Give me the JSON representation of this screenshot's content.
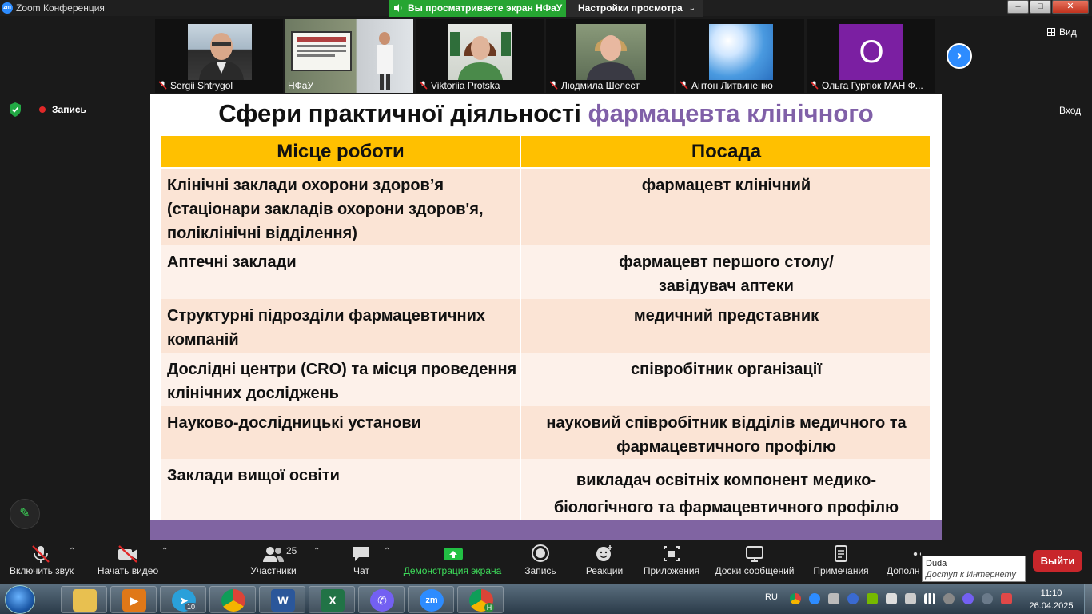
{
  "window": {
    "title": "Zoom Конференция",
    "share_banner": "Вы просматриваете экран НФаУ",
    "view_options": "Настройки просмотра",
    "minimize": "–",
    "maximize": "□",
    "close": "✕"
  },
  "participants_strip": {
    "tiles": [
      {
        "name": "Sergii Shtrygol",
        "muted": true
      },
      {
        "name": "НФаУ",
        "muted": false,
        "active": true
      },
      {
        "name": "Viktoriia Protska",
        "muted": true
      },
      {
        "name": "Людмила Шелест",
        "muted": true
      },
      {
        "name": "Антон Литвиненко",
        "muted": true
      },
      {
        "name": "Ольга Гуртюк МАН Ф...",
        "muted": true,
        "avatar_letter": "О"
      }
    ],
    "next_arrow": "›",
    "view_button": "Вид"
  },
  "recording": {
    "label": "Запись"
  },
  "signin": {
    "label": "Вход"
  },
  "slide": {
    "title_main": "Сфери практичної діяльності ",
    "title_accent": "фармацевта клінічного",
    "table": {
      "headers": [
        "Місце роботи",
        "Посада"
      ],
      "rows": [
        {
          "place": "Клінічні заклади охорони здоров’я (стаціонари закладів охорони здоров'я, поліклінічні відділення)",
          "position": "фармацевт клінічний"
        },
        {
          "place": "Аптечні заклади",
          "position": "фармацевт першого столу/ завідувач аптеки"
        },
        {
          "place": "Структурні підрозділи  фармацевтичних компаній",
          "position": "медичний представник"
        },
        {
          "place": "Дослідні центри (CRO) та місця проведення клінічних досліджень",
          "position": "співробітник організації"
        },
        {
          "place": "Науково-дослідницькі установи",
          "position": "науковий співробітник відділів медичного та фармацевтичного профілю"
        },
        {
          "place": "Заклади вищої освіти",
          "position": "викладач освітніх компонент медико-біологічного та фармацевтичного профілю"
        }
      ]
    }
  },
  "toolbar": {
    "unmute": "Включить звук",
    "start_video": "Начать видео",
    "participants": "Участники",
    "participants_count": "25",
    "chat": "Чат",
    "share_screen": "Демонстрация экрана",
    "record": "Запись",
    "reactions": "Реакции",
    "apps": "Приложения",
    "whiteboards": "Доски сообщений",
    "notes": "Примечания",
    "more": "Дополн",
    "leave": "Выйти"
  },
  "tooltip": {
    "title": "Duda",
    "subtitle": "Доступ к Интернету"
  },
  "taskbar": {
    "language": "RU",
    "time": "11:10",
    "date": "26.04.2025",
    "telegram_badge": "10",
    "chrome_badge": "H",
    "apps": [
      "explorer",
      "media-player",
      "telegram",
      "chrome",
      "word",
      "excel",
      "viber",
      "zoom",
      "chrome-profile"
    ]
  },
  "colors": {
    "header_bg": "#ffc000",
    "row_odd": "#fbe4d5",
    "row_even": "#fdf1ea",
    "accent_purple": "#8060a8",
    "footer_purple": "#8064a2",
    "share_green": "#26a532",
    "leave_red": "#c8262b"
  }
}
